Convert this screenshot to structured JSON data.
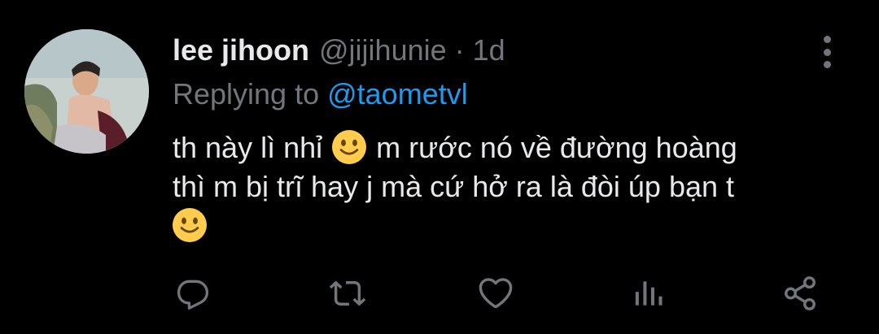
{
  "tweet": {
    "display_name": "lee jihoon",
    "handle": "@jijihunie",
    "separator": "·",
    "time": "1d",
    "reply_prefix": "Replying to",
    "reply_handle": "@taometvl",
    "body_line1_a": "th này lì nhỉ",
    "body_line1_b": "m rước nó về đường hoàng",
    "body_line2": "thì m bị trĩ hay j mà cứ hở ra là đòi úp bạn t",
    "emoji": "slightly-smiling-face"
  },
  "actions": [
    {
      "icon": "reply-icon"
    },
    {
      "icon": "retweet-icon"
    },
    {
      "icon": "like-icon"
    },
    {
      "icon": "analytics-icon"
    },
    {
      "icon": "share-icon"
    }
  ],
  "colors": {
    "background": "#000000",
    "text": "#e7e9ea",
    "muted": "#71767b",
    "link": "#1d9bf0",
    "emoji": "#ffcc4d"
  }
}
